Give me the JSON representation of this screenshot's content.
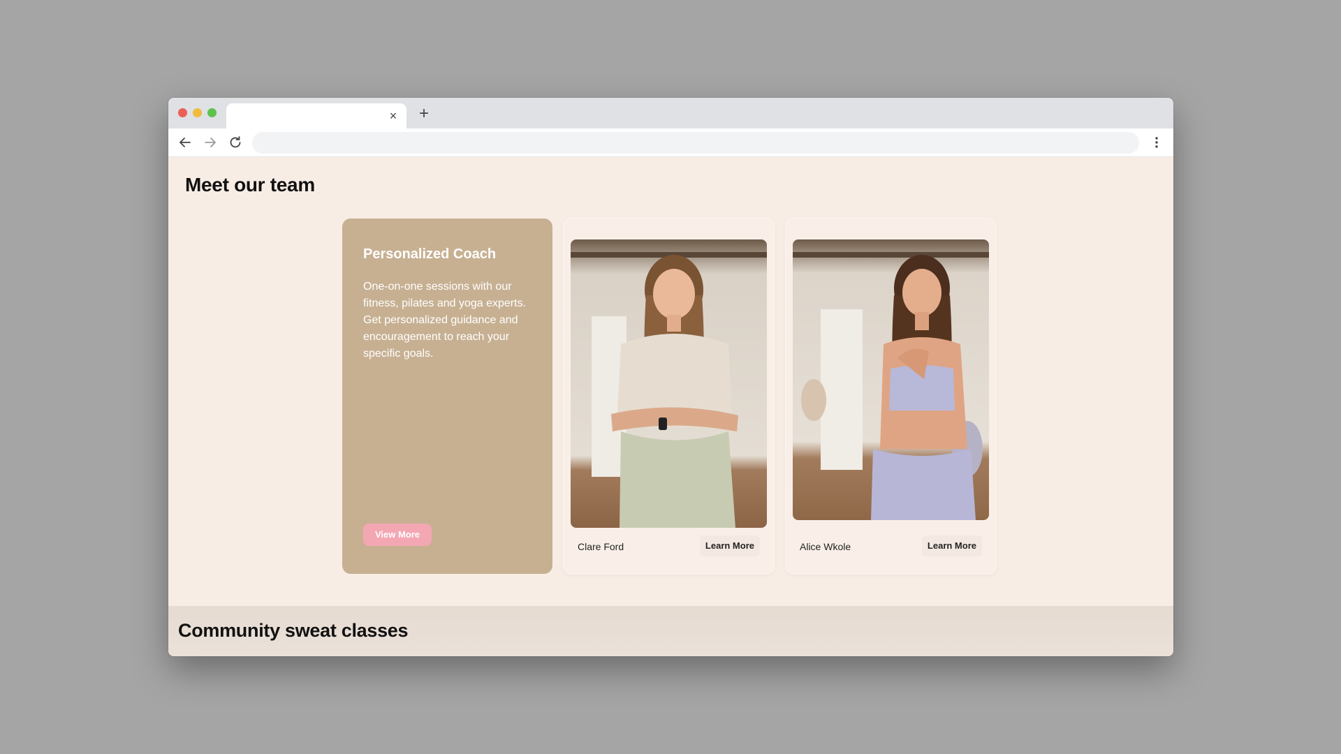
{
  "browser": {
    "tab_close_label": "×",
    "new_tab_label": "+"
  },
  "team": {
    "heading": "Meet our team",
    "intro": {
      "title": "Personalized Coach",
      "paragraph_1": "One-on-one sessions with our fitness, pilates and yoga experts.",
      "paragraph_2": "Get personalized guidance and encouragement to reach your specific goals.",
      "button": "View More"
    },
    "members": [
      {
        "name": "Clare Ford",
        "button": "Learn More"
      },
      {
        "name": "Alice Wkole",
        "button": "Learn More"
      }
    ]
  },
  "community": {
    "heading": "Community sweat classes"
  },
  "colors": {
    "page_bg": "#f8ede5",
    "intro_card": "#c7b092",
    "view_more_button": "#f3a7b3"
  }
}
